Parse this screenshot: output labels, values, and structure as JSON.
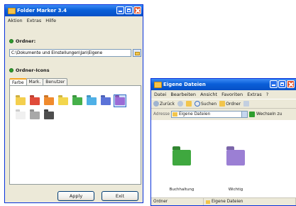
{
  "left_window": {
    "title": "Folder Marker 3.4",
    "menu": [
      "Aktion",
      "Extras",
      "Hilfe"
    ],
    "folder_section_label": "Ordner:",
    "folder_path": "C:\\Dokumente und Einstellungen\\Jan\\Eigene",
    "icon_section_label": "Ordner-Icons",
    "tabs": [
      "Farbe",
      "Mark.",
      "Benutzer"
    ],
    "ok_button": "Apply",
    "cancel_button": "Exit",
    "folder_colors": [
      "#f4cf4e",
      "#e04b3a",
      "#f08b2e",
      "#f3d64c",
      "#46b04a",
      "#4fb0e6",
      "#5b73d8",
      "#9b6bd6",
      "#f0f0f0",
      "#a8a8a8",
      "#4e4e4e"
    ],
    "selected_color_index": 7
  },
  "right_window": {
    "title": "Eigene Dateien",
    "menu": [
      "Datei",
      "Bearbeiten",
      "Ansicht",
      "Favoriten",
      "Extras",
      "?"
    ],
    "toolbar": {
      "back": "Zurück",
      "search": "Suchen",
      "folders": "Ordner"
    },
    "address_label": "Adresse",
    "address_value": "Eigene Dateien",
    "go_label": "Wechseln zu",
    "items": [
      {
        "label": "Buchhaltung",
        "color": "#3fa83f"
      },
      {
        "label": "Wichtig",
        "color": "#9b7fd4"
      }
    ],
    "status_left": "Ordner",
    "status_right": "Eigene Dateien"
  }
}
